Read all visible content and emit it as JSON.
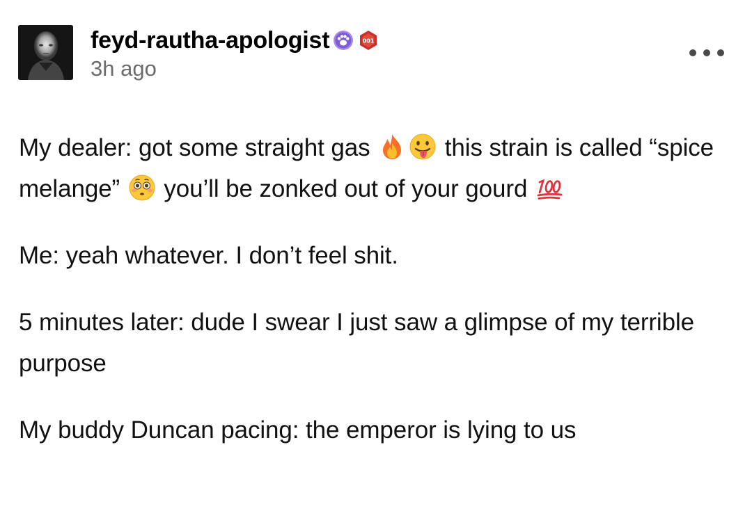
{
  "post": {
    "username": "feyd-rautha-apologist",
    "timestamp": "3h ago",
    "badges": [
      {
        "icon": "paw-print-badge-icon",
        "color": "#8e6bd9"
      },
      {
        "icon": "hexagon-number-badge-icon",
        "color": "#c8302c",
        "text": "001"
      }
    ],
    "more_icon": "more-options-icon",
    "paragraphs": [
      {
        "t1": "My dealer: got some straight gas ",
        "e1": "fire-emoji-icon",
        "e2": "tongue-out-emoji-icon",
        "t2": " this strain is called “spice melange” ",
        "e3": "flushed-face-emoji-icon",
        "t3": " you’ll be zonked out of your gourd ",
        "e4": "hundred-points-emoji-icon"
      },
      {
        "text": "Me: yeah whatever. I don’t feel shit."
      },
      {
        "text": "5 minutes later: dude I swear I just saw a glimpse of my terrible purpose"
      },
      {
        "text": "My buddy Duncan pacing: the emperor is lying to us"
      }
    ]
  }
}
